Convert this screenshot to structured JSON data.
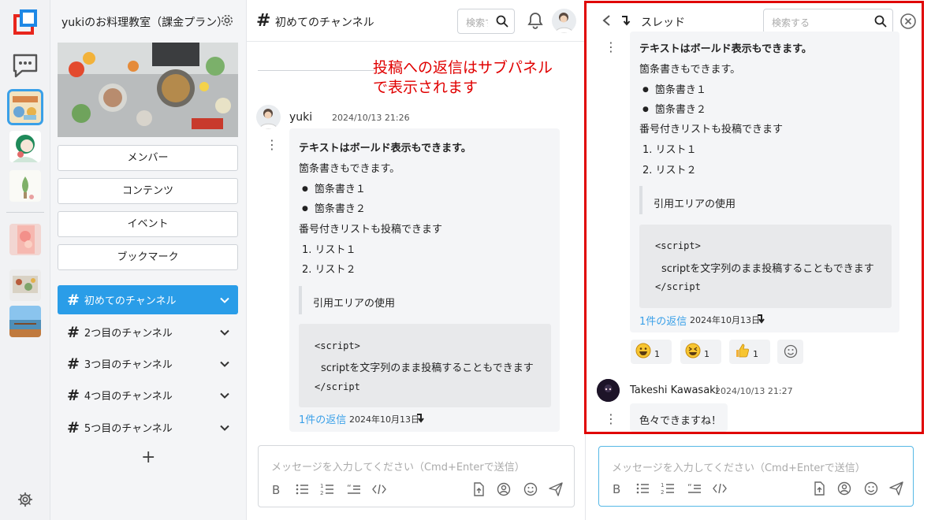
{
  "sidebar": {
    "title": "yukiのお料理教室（課金プラン）",
    "buttons": [
      "メンバー",
      "コンテンツ",
      "イベント",
      "ブックマーク"
    ],
    "channels": [
      "初めてのチャンネル",
      "2つ目のチャンネル",
      "3つ目のチャンネル",
      "4つ目のチャンネル",
      "5つ目のチャンネル"
    ],
    "active_channel": 0,
    "add_label": "+"
  },
  "header": {
    "channel_hash": "#",
    "channel_name": "初めてのチャンネル",
    "search_placeholder": "検索する"
  },
  "annotation": {
    "line1": "投稿への返信はサブパネル",
    "line2": "で表示されます"
  },
  "post": {
    "user": "yuki",
    "time": "2024/10/13 21:26",
    "bold_line": "テキストはボールド表示もできます。",
    "bullet_intro": "箇条書きもできます。",
    "bullets": [
      "箇条書き１",
      "箇条書き２"
    ],
    "numbered_intro": "番号付きリストも投稿できます",
    "numbered": [
      "1. リスト１",
      "2. リスト２"
    ],
    "quote": "引用エリアの使用",
    "code_open": "<script>",
    "code_body": "scriptを文字列のまま投稿することもできます",
    "code_close": "</script",
    "reply_link": "1件の返信",
    "reply_date": "2024年10月13日"
  },
  "thread": {
    "title": "スレッド",
    "search_placeholder": "検索する",
    "bold_line": "テキストはボールド表示もできます。",
    "bullet_intro": "箇条書きもできます。",
    "bullets": [
      "箇条書き１",
      "箇条書き２"
    ],
    "numbered_intro": "番号付きリストも投稿できます",
    "numbered": [
      "1. リスト１",
      "2. リスト２"
    ],
    "quote": "引用エリアの使用",
    "code_open": "<script>",
    "code_body": "scriptを文字列のまま投稿することもできます",
    "code_close": "</script",
    "reply_link": "1件の返信",
    "reply_date": "2024年10月13日",
    "reactions": [
      {
        "emoji": "grinning-face",
        "count": "1"
      },
      {
        "emoji": "squinting-face",
        "count": "1"
      },
      {
        "emoji": "thumbs-up",
        "count": "1"
      }
    ],
    "reply": {
      "user": "Takeshi Kawasaki",
      "time": "2024/10/13 21:27",
      "text": "色々できますね！"
    }
  },
  "composer": {
    "placeholder": "メッセージを入力してください（Cmd+Enterで送信）",
    "tools": [
      "bold",
      "bulleted-list",
      "numbered-list",
      "quote",
      "code",
      "upload",
      "mention",
      "emoji",
      "send"
    ]
  },
  "colors": {
    "accent": "#2a9de8",
    "annotation": "#e00000",
    "link": "#3aa0e8"
  }
}
